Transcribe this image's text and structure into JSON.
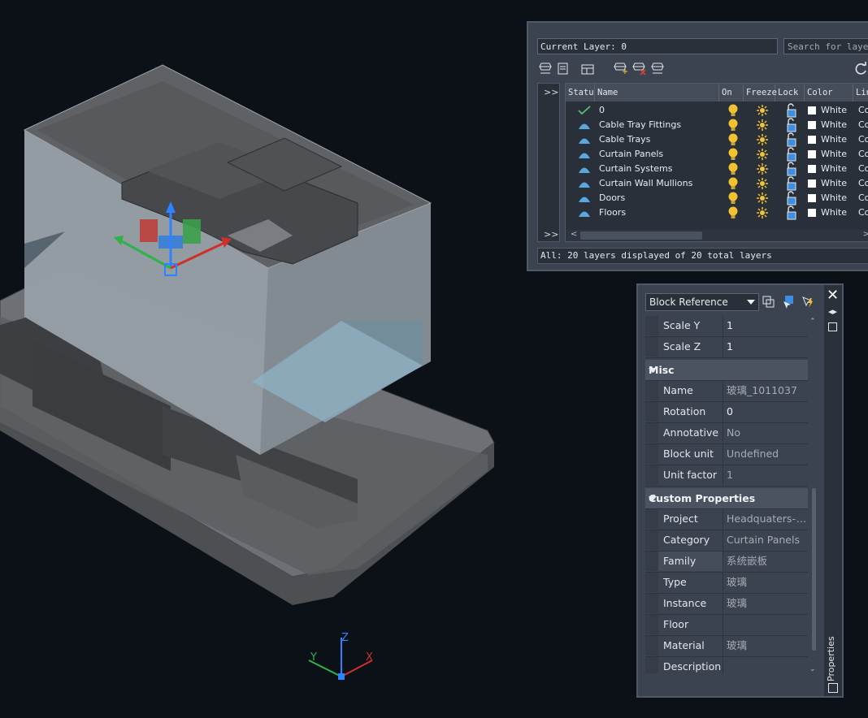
{
  "layer_manager": {
    "current_layer": "Current Layer: 0",
    "search_placeholder": "Search for layer",
    "headers": {
      "status": "Statu",
      "name": "Name",
      "on": "On",
      "freeze": "Freeze",
      "lock": "Lock",
      "color": "Color",
      "linetype": "Lin"
    },
    "expand_label": ">>",
    "layers": [
      {
        "name": "0",
        "color": "White",
        "linetype": "Co",
        "current": true
      },
      {
        "name": "Cable Tray Fittings",
        "color": "White",
        "linetype": "Co"
      },
      {
        "name": "Cable Trays",
        "color": "White",
        "linetype": "Co"
      },
      {
        "name": "Curtain Panels",
        "color": "White",
        "linetype": "Co"
      },
      {
        "name": "Curtain Systems",
        "color": "White",
        "linetype": "Co"
      },
      {
        "name": "Curtain Wall Mullions",
        "color": "White",
        "linetype": "Co"
      },
      {
        "name": "Doors",
        "color": "White",
        "linetype": "Co"
      },
      {
        "name": "Floors",
        "color": "White",
        "linetype": "Co"
      }
    ],
    "status_text": "All: 20 layers displayed of 20 total layers"
  },
  "properties": {
    "object_type": "Block Reference",
    "side_label": "Properties",
    "top_rows": [
      {
        "key": "Scale Y",
        "value": "1"
      },
      {
        "key": "Scale Z",
        "value": "1"
      }
    ],
    "misc_title": "Misc",
    "misc_rows": [
      {
        "key": "Name",
        "value": "玻璃_1011037",
        "dim": true
      },
      {
        "key": "Rotation",
        "value": "0"
      },
      {
        "key": "Annotative",
        "value": "No",
        "dim": true
      },
      {
        "key": "Block unit",
        "value": "Undefined",
        "dim": true
      },
      {
        "key": "Unit factor",
        "value": "1",
        "dim": true
      }
    ],
    "custom_title": "Custom Properties",
    "custom_rows": [
      {
        "key": "Project",
        "value": "Headquaters-J...",
        "dim": true
      },
      {
        "key": "Category",
        "value": "Curtain Panels",
        "dim": true
      },
      {
        "key": "Family",
        "value": "系统嵌板",
        "dim": true
      },
      {
        "key": "Type",
        "value": "玻璃",
        "dim": true
      },
      {
        "key": "Instance",
        "value": "玻璃",
        "dim": true
      },
      {
        "key": "Floor",
        "value": "",
        "dim": true
      },
      {
        "key": "Material",
        "value": "玻璃",
        "dim": true
      },
      {
        "key": "Description",
        "value": "",
        "dim": true
      }
    ]
  },
  "ucs": {
    "x": "X",
    "y": "Y",
    "z": "Z"
  },
  "colors": {
    "background": "#0c1117",
    "panel": "#3b4350",
    "lightbulb": "#f2c230",
    "layer_icon": "#5aa7e0"
  }
}
